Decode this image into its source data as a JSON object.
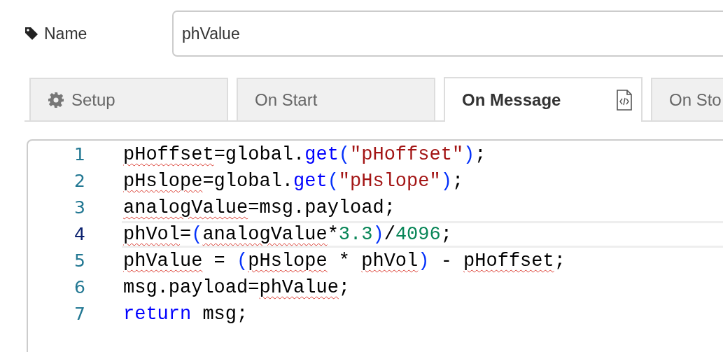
{
  "name_field": {
    "label": "Name",
    "value": "phValue"
  },
  "tabs": [
    {
      "label": "Setup",
      "selected": false
    },
    {
      "label": "On Start",
      "selected": false
    },
    {
      "label": "On Message",
      "selected": true
    },
    {
      "label": "On Sto",
      "selected": false
    }
  ],
  "editor": {
    "lines": [
      {
        "number": "1",
        "current": false,
        "tokens": [
          {
            "text": "pHoffset",
            "kind": "error"
          },
          {
            "text": "=global.",
            "kind": "plain"
          },
          {
            "text": "get",
            "kind": "method"
          },
          {
            "text": "(",
            "kind": "bracket"
          },
          {
            "text": "\"pHoffset\"",
            "kind": "string"
          },
          {
            "text": ")",
            "kind": "bracket"
          },
          {
            "text": ";",
            "kind": "plain"
          }
        ]
      },
      {
        "number": "2",
        "current": false,
        "tokens": [
          {
            "text": "pHslope",
            "kind": "error"
          },
          {
            "text": "=global.",
            "kind": "plain"
          },
          {
            "text": "get",
            "kind": "method"
          },
          {
            "text": "(",
            "kind": "bracket"
          },
          {
            "text": "\"pHslope\"",
            "kind": "string"
          },
          {
            "text": ")",
            "kind": "bracket"
          },
          {
            "text": ";",
            "kind": "plain"
          }
        ]
      },
      {
        "number": "3",
        "current": false,
        "tokens": [
          {
            "text": "analogValue",
            "kind": "error"
          },
          {
            "text": "=msg.payload;",
            "kind": "plain"
          }
        ]
      },
      {
        "number": "4",
        "current": true,
        "tokens": [
          {
            "text": "phVol",
            "kind": "error"
          },
          {
            "text": "=",
            "kind": "plain"
          },
          {
            "text": "(",
            "kind": "bracket"
          },
          {
            "text": "analogValue",
            "kind": "error"
          },
          {
            "text": "*",
            "kind": "plain"
          },
          {
            "text": "3.3",
            "kind": "number"
          },
          {
            "text": ")",
            "kind": "bracket"
          },
          {
            "text": "/",
            "kind": "plain"
          },
          {
            "text": "4096",
            "kind": "number"
          },
          {
            "text": ";",
            "kind": "plain"
          }
        ]
      },
      {
        "number": "5",
        "current": false,
        "tokens": [
          {
            "text": "phValue",
            "kind": "error"
          },
          {
            "text": " = ",
            "kind": "plain"
          },
          {
            "text": "(",
            "kind": "bracket"
          },
          {
            "text": "pHslope",
            "kind": "error"
          },
          {
            "text": " * ",
            "kind": "plain"
          },
          {
            "text": "phVol",
            "kind": "error"
          },
          {
            "text": ")",
            "kind": "bracket"
          },
          {
            "text": " - ",
            "kind": "plain"
          },
          {
            "text": "pHoffset",
            "kind": "error"
          },
          {
            "text": ";",
            "kind": "plain"
          }
        ]
      },
      {
        "number": "6",
        "current": false,
        "tokens": [
          {
            "text": "msg.payload=",
            "kind": "plain"
          },
          {
            "text": "phValue",
            "kind": "error"
          },
          {
            "text": ";",
            "kind": "plain"
          }
        ]
      },
      {
        "number": "7",
        "current": false,
        "tokens": [
          {
            "text": "return",
            "kind": "keyword"
          },
          {
            "text": " msg;",
            "kind": "plain"
          }
        ]
      }
    ]
  }
}
